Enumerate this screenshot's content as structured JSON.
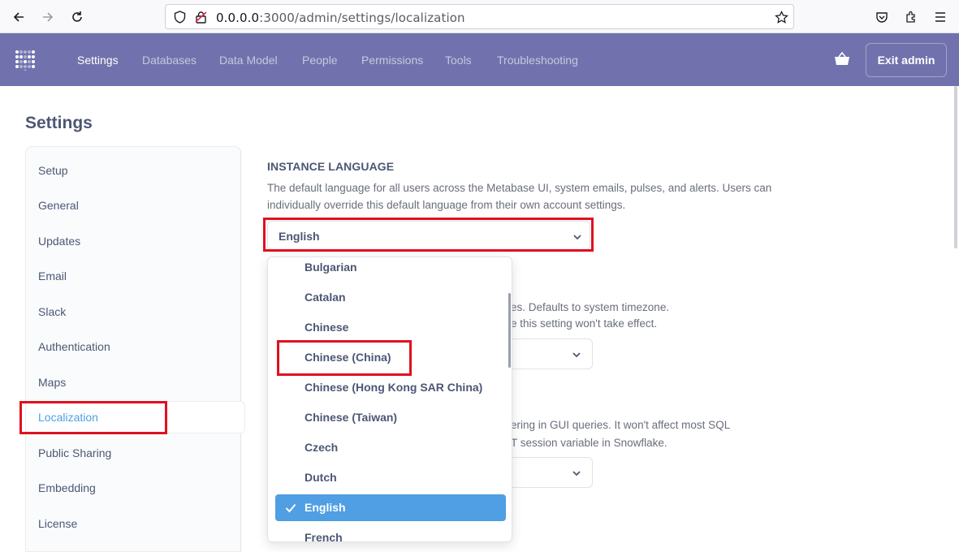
{
  "browser": {
    "url_host": "0.0.0.0",
    "url_path": ":3000/admin/settings/localization"
  },
  "nav": {
    "items": [
      "Settings",
      "Databases",
      "Data Model",
      "People",
      "Permissions",
      "Tools",
      "Troubleshooting"
    ],
    "exit_label": "Exit admin"
  },
  "page": {
    "title": "Settings"
  },
  "sidebar": {
    "items": [
      "Setup",
      "General",
      "Updates",
      "Email",
      "Slack",
      "Authentication",
      "Maps",
      "Localization",
      "Public Sharing",
      "Embedding",
      "License"
    ],
    "active": "Localization"
  },
  "instance_language": {
    "heading": "INSTANCE LANGUAGE",
    "desc_line1": "The default language for all users across the Metabase UI, system emails, pulses, and alerts. Users can",
    "desc_line2": "individually override this default language from their own account settings.",
    "selected": "English"
  },
  "timezone": {
    "desc_line1": "es. Defaults to system timezone.",
    "desc_line2": "e this setting won't take effect."
  },
  "start_of_week": {
    "desc_line1": "ering in GUI queries. It won't affect most SQL",
    "desc_line2": "T session variable in Snowflake."
  },
  "dropdown": {
    "options": [
      "Bulgarian",
      "Catalan",
      "Chinese",
      "Chinese (China)",
      "Chinese (Hong Kong SAR China)",
      "Chinese (Taiwan)",
      "Czech",
      "Dutch",
      "English",
      "French"
    ],
    "selected": "English"
  },
  "colors": {
    "nav_bg": "#7172ad",
    "accent": "#509ee3",
    "highlight": "#e0101f"
  }
}
